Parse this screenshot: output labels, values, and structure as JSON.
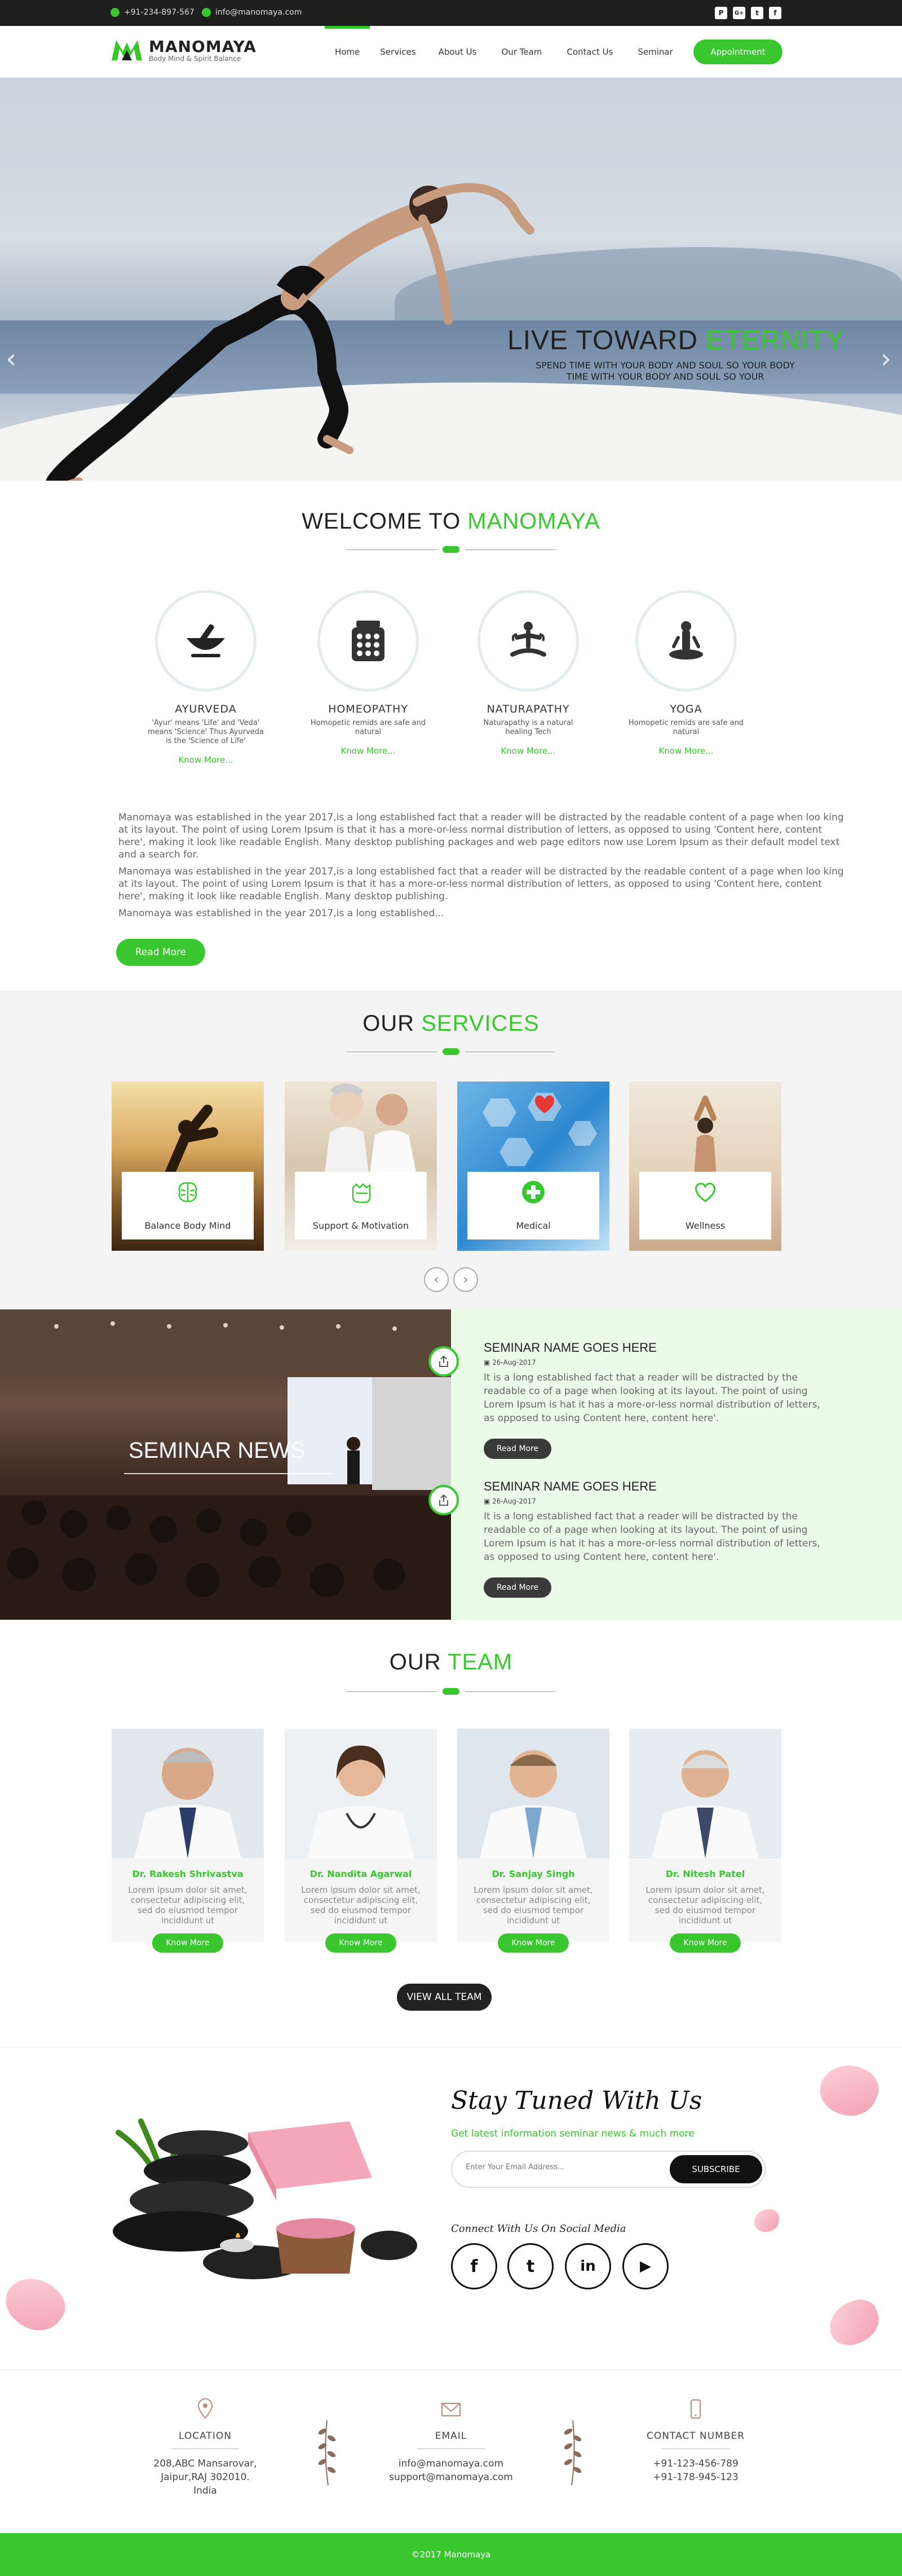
{
  "topbar": {
    "phone": "+91-234-897-567",
    "email": "info@manomaya.com",
    "social": [
      "P",
      "G+",
      "t",
      "f"
    ]
  },
  "brand": {
    "name": "MANOMAYA",
    "tagline": "Body Mind & Spirit Balance",
    "accent": "#39c62f"
  },
  "nav": {
    "items": [
      "Home",
      "Services",
      "About Us",
      "Our Team",
      "Contact Us",
      "Seminar"
    ],
    "active": "Home",
    "cta": "Appointment"
  },
  "hero": {
    "title_a": "LIVE TOWARD ",
    "title_b": "ETERNITY",
    "sub1": "SPEND TIME WITH YOUR BODY AND SOUL SO YOUR BODY",
    "sub2": "TIME WITH YOUR BODY AND SOUL SO YOUR"
  },
  "welcome": {
    "title_a": "WELCOME TO ",
    "title_b": "MANOMAYA",
    "features": [
      {
        "name": "AYURVEDA",
        "desc": "'Ayur' means 'Life' and 'Veda' means 'Science' Thus Ayurveda is the 'Science of Life'",
        "link": "Know More...",
        "icon": "mortar-pestle-icon"
      },
      {
        "name": "HOMEOPATHY",
        "desc": "Homopetic remids are safe and natural",
        "link": "Know More...",
        "icon": "pill-jar-icon"
      },
      {
        "name": "NATURAPATHY",
        "desc": "Naturapathy is a natural healing Tech",
        "link": "Know More...",
        "icon": "meditation-icon"
      },
      {
        "name": "YOGA",
        "desc": "Homopetic remids are safe and natural",
        "link": "Know More...",
        "icon": "yoga-pose-icon"
      }
    ],
    "p1": "Manomaya was established in the year 2017,is a long established fact that a reader will be distracted by the readable content of a page when loo king at its layout. The point of using Lorem Ipsum is that it has a more-or-less normal distribution of letters, as opposed to using 'Content here, content here', making it look like readable English. Many desktop publishing packages and web page editors now use Lorem Ipsum as their default model text and a search for.",
    "p2": "Manomaya was established in the year 2017,is a long established fact that a reader will be distracted by the readable content of a page when loo king at its layout. The point of using Lorem Ipsum is that it has a more-or-less normal distribution of letters, as opposed to using 'Content here, content here', making it look like readable English. Many desktop publishing.",
    "p3": "Manomaya was established in the year 2017,is a long established...",
    "button": "Read More"
  },
  "services": {
    "title_a": "OUR ",
    "title_b": "SERVICES",
    "items": [
      {
        "label": "Balance Body Mind",
        "icon": "brain-icon"
      },
      {
        "label": "Support & Motivation",
        "icon": "fist-icon"
      },
      {
        "label": "Medical",
        "icon": "medical-cross-icon"
      },
      {
        "label": "Wellness",
        "icon": "heart-icon"
      }
    ],
    "prev": "‹",
    "next": "›"
  },
  "seminar": {
    "section_label": "SEMINAR NEWS",
    "items": [
      {
        "title": "SEMINAR NAME GOES HERE",
        "date": "26-Aug-2017",
        "text": "It is a long established fact that a reader will be distracted by the readable co of a page when looking at its layout. The point of using Lorem Ipsum is hat it has a more-or-less normal distribution of letters, as opposed to using Content here, content here'.",
        "button": "Read More"
      },
      {
        "title": "SEMINAR NAME GOES HERE",
        "date": "26-Aug-2017",
        "text": "It is a long established fact that a reader will be distracted by the readable co of a page when looking at its layout. The point of using Lorem Ipsum is hat it has a more-or-less normal distribution of letters, as opposed to using Content here, content here'.",
        "button": "Read More"
      }
    ]
  },
  "team": {
    "title_a": "OUR ",
    "title_b": "TEAM",
    "members": [
      {
        "name": "Dr. Rakesh Shrivastva",
        "text": "Lorem ipsum dolor sit amet, consectetur adipiscing elit, sed do eiusmod tempor incididunt ut",
        "button": "Know More"
      },
      {
        "name": "Dr. Nandita Agarwal",
        "text": "Lorem ipsum dolor sit amet, consectetur adipiscing elit, sed do eiusmod tempor incididunt ut",
        "button": "Know More"
      },
      {
        "name": "Dr. Sanjay Singh",
        "text": "Lorem ipsum dolor sit amet, consectetur adipiscing elit, sed do eiusmod tempor incididunt ut",
        "button": "Know More"
      },
      {
        "name": "Dr. Nitesh Patel",
        "text": "Lorem ipsum dolor sit amet, consectetur adipiscing elit, sed do eiusmod tempor incididunt ut",
        "button": "Know More"
      }
    ],
    "view_all": "VIEW ALL TEAM"
  },
  "newsletter": {
    "title": "Stay Tuned With Us",
    "subtitle": "Get latest information seminar news & much more",
    "placeholder": "Enter Your Email Address...",
    "button": "SUBSCRIBE",
    "connect": "Connect With Us On Social Media",
    "social": [
      "f",
      "t",
      "in",
      "▶"
    ]
  },
  "contact": {
    "location": {
      "title": "LOCATION",
      "l1": "208,ABC Mansarovar,",
      "l2": "Jaipur,RAJ 302010.",
      "l3": "India"
    },
    "email": {
      "title": "EMAIL",
      "l1": "info@manomaya.com",
      "l2": "support@manomaya.com"
    },
    "phone": {
      "title": "CONTACT NUMBER",
      "l1": "+91-123-456-789",
      "l2": "+91-178-945-123"
    }
  },
  "footer": {
    "copyright": "©2017 Manomaya"
  }
}
